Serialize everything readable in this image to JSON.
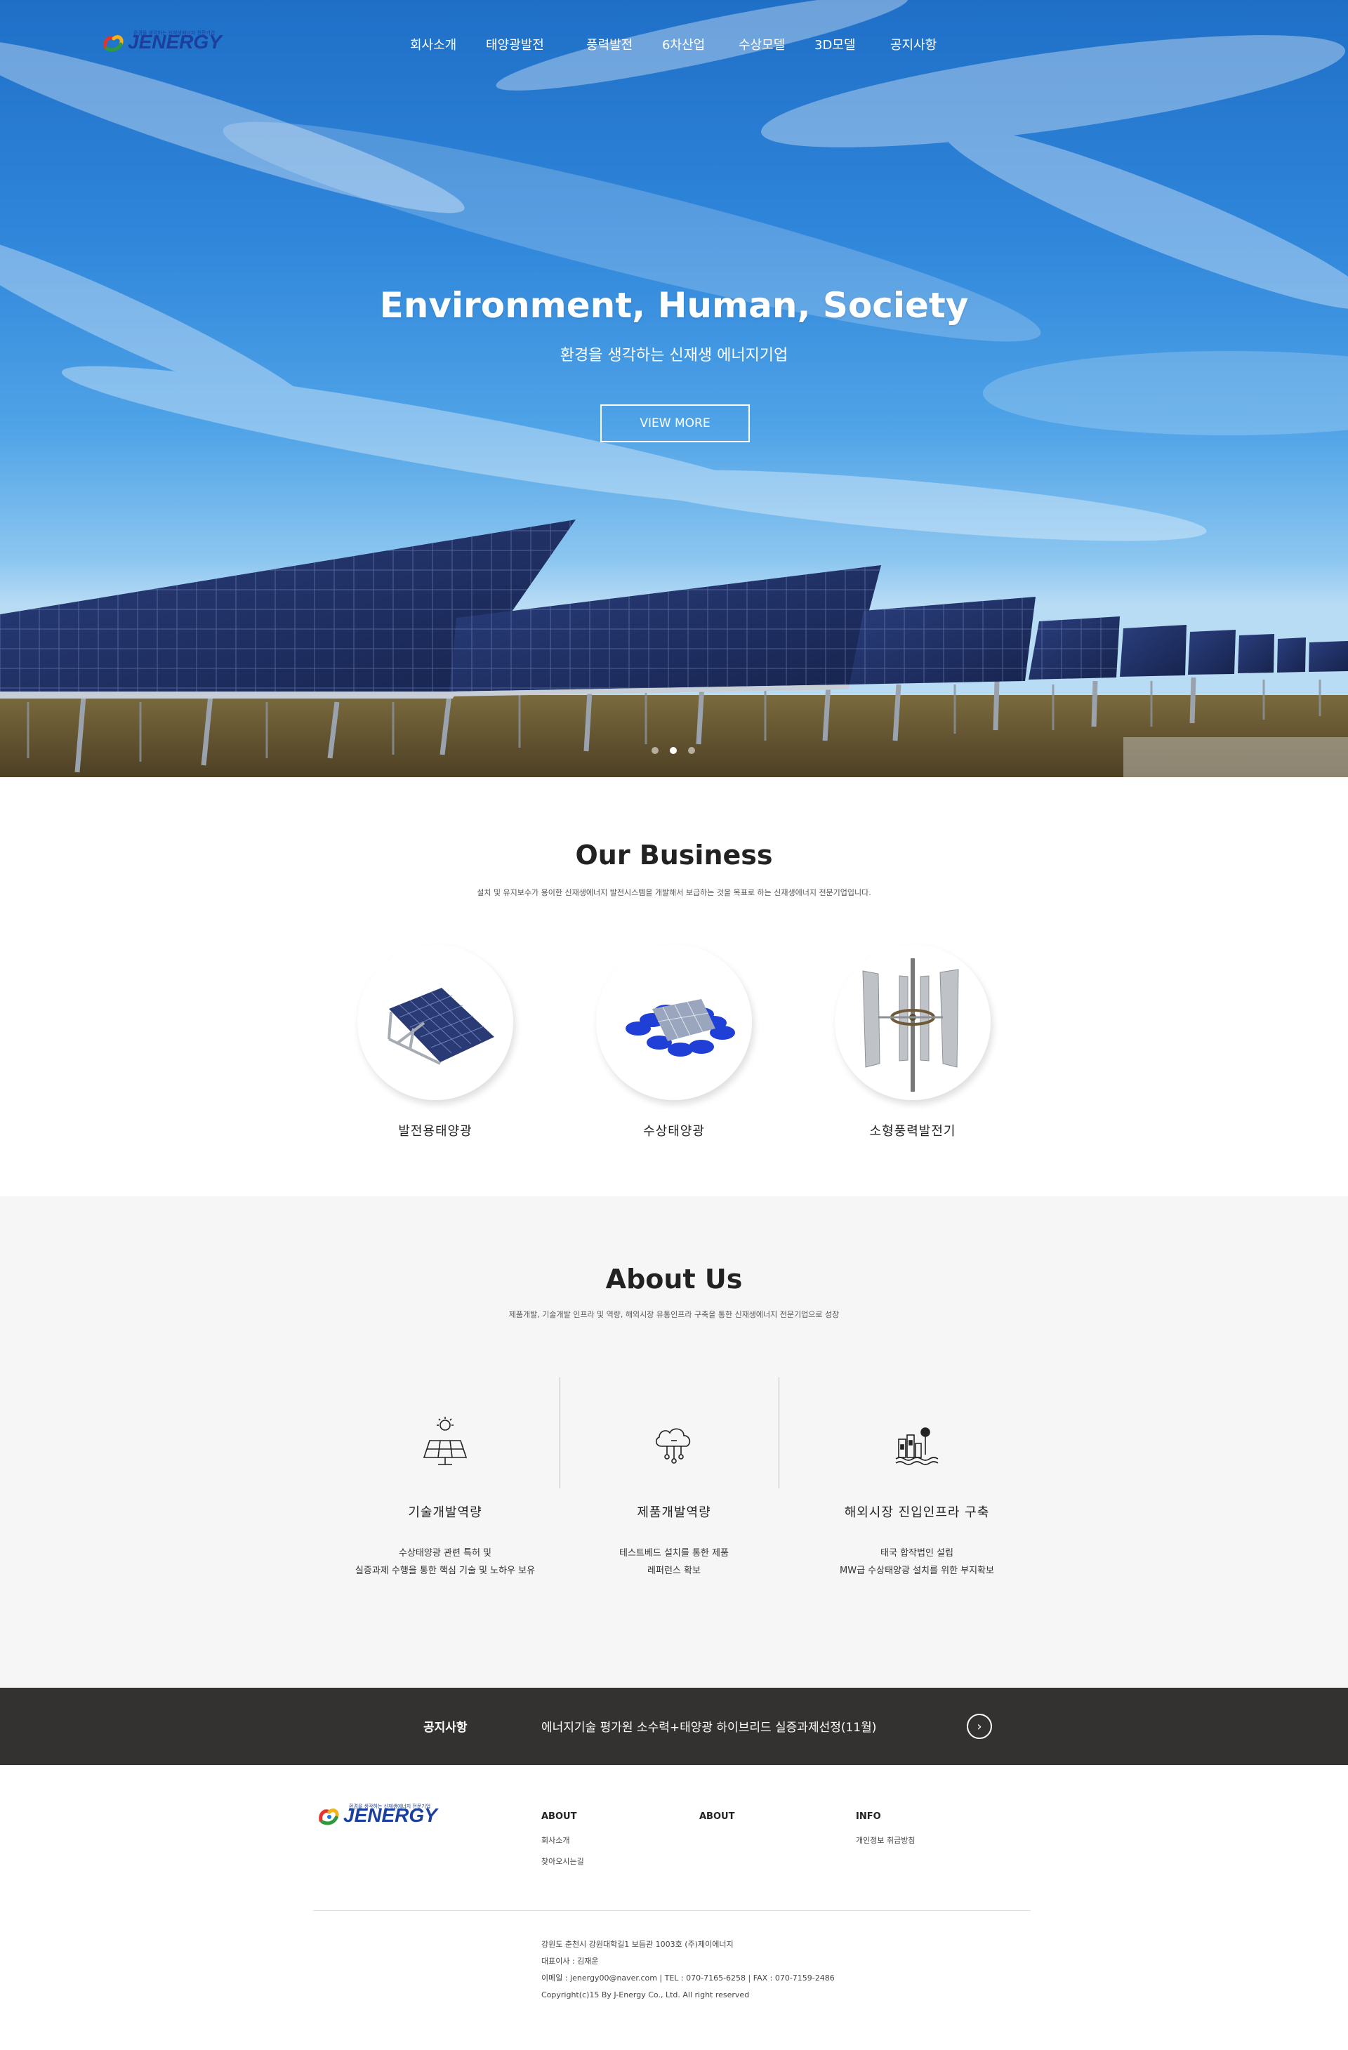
{
  "brand": {
    "name": "JENERGY",
    "tagline": "환경을 생각하는 신재생에너지 전문기업"
  },
  "nav": [
    {
      "label": "회사소개"
    },
    {
      "label": "태양광발전"
    },
    {
      "label": "풍력발전"
    },
    {
      "label": "6차산업"
    },
    {
      "label": "수상모델"
    },
    {
      "label": "3D모델"
    },
    {
      "label": "공지사항"
    }
  ],
  "hero": {
    "title": "Environment, Human, Society",
    "subtitle": "환경을 생각하는 신재생 에너지기업",
    "cta": "VIEW MORE",
    "slide_count": 3,
    "active_slide": 2
  },
  "business": {
    "title": "Our Business",
    "description": "설치 및 유지보수가 용이한 신재생에너지 발전시스템을 개발해서 보급하는 것을 목표로 하는 신재생에너지 전문기업입니다.",
    "items": [
      {
        "label": "발전용태양광",
        "icon": "ground-solar-panel"
      },
      {
        "label": "수상태양광",
        "icon": "floating-solar-panel"
      },
      {
        "label": "소형풍력발전기",
        "icon": "vertical-wind-turbine"
      }
    ]
  },
  "about": {
    "title": "About Us",
    "description": "제품개발, 기술개발 인프라 및 역량, 해외시장 유통인프라 구축을 통한 신재생에너지 전문기업으로 성장",
    "items": [
      {
        "title": "기술개발역량",
        "icon": "solar-panel-sun-icon",
        "line1": "수상태양광 관련 특허 및",
        "line2": "실증과제 수행을 통한 핵심 기술 및 노하우 보유"
      },
      {
        "title": "제품개발역량",
        "icon": "cloud-network-icon",
        "line1": "테스트베드 설치를 통한 제품",
        "line2": "레퍼런스 확보"
      },
      {
        "title": "해외시장 진입인프라 구축",
        "icon": "factory-water-icon",
        "line1": "태국 합작법인 설립",
        "line2": "MW급 수상태양광 설치를 위한 부지확보"
      }
    ]
  },
  "notice": {
    "label": "공지사항",
    "text": "에너지기술 평가원 소수력+태양광 하이브리드 실증과제선정(11월)"
  },
  "footer": {
    "columns": [
      {
        "heading": "ABOUT",
        "links": [
          "회사소개",
          "찾아오시는길"
        ]
      },
      {
        "heading": "ABOUT",
        "links": []
      },
      {
        "heading": "INFO",
        "links": [
          "개인정보 취급방침"
        ]
      }
    ],
    "address": "강원도 춘천시 강원대학길1 보듬관 1003호 (주)제이에너지",
    "ceo": "대표이사 : 김재운",
    "contact": "이메일 : jenergy00@naver.com | TEL : 070-7165-6258 | FAX : 070-7159-2486",
    "copyright": "Copyright(c)15 By J-Energy Co., Ltd. All right reserved"
  },
  "colors": {
    "brand_blue": "#1b3f9c",
    "notice_bg": "#333230",
    "about_bg": "#f6f6f6"
  }
}
